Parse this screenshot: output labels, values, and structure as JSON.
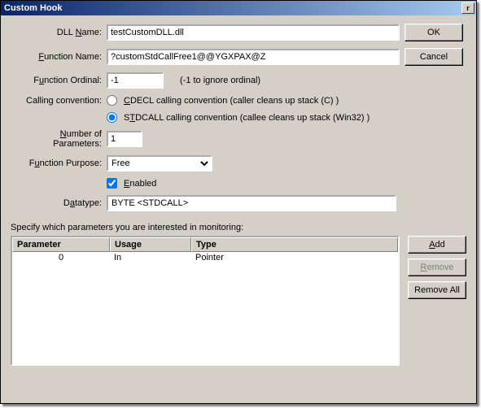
{
  "title": "Custom Hook",
  "buttons": {
    "ok": "OK",
    "cancel": "Cancel",
    "add": "Add",
    "remove": "Remove",
    "removeAll": "Remove All"
  },
  "labels": {
    "dllName": "DLL Name:",
    "functionName": "Function Name:",
    "functionOrdinal": "Function Ordinal:",
    "ordinalHint": "(-1 to ignore ordinal)",
    "callingConvention": "Calling convention:",
    "cdecl": "CDECL calling convention (caller cleans up stack (C) )",
    "stdcall": "STDCALL calling convention (callee cleans up stack (Win32) )",
    "numParams": "Number of Parameters:",
    "functionPurpose": "Function Purpose:",
    "enabled": "Enabled",
    "datatype": "Datatype:",
    "specify": "Specify which parameters you are interested in monitoring:"
  },
  "fields": {
    "dllName": "testCustomDLL.dll",
    "functionName": "?customStdCallFree1@@YGXPAX@Z",
    "functionOrdinal": "-1",
    "numParams": "1",
    "functionPurpose": "Free",
    "enabledChecked": true,
    "callingIsStdcall": true,
    "datatype": "BYTE <STDCALL>"
  },
  "table": {
    "headers": {
      "parameter": "Parameter",
      "usage": "Usage",
      "type": "Type"
    },
    "rows": [
      {
        "parameter": "0",
        "usage": "In",
        "type": "Pointer"
      }
    ]
  }
}
